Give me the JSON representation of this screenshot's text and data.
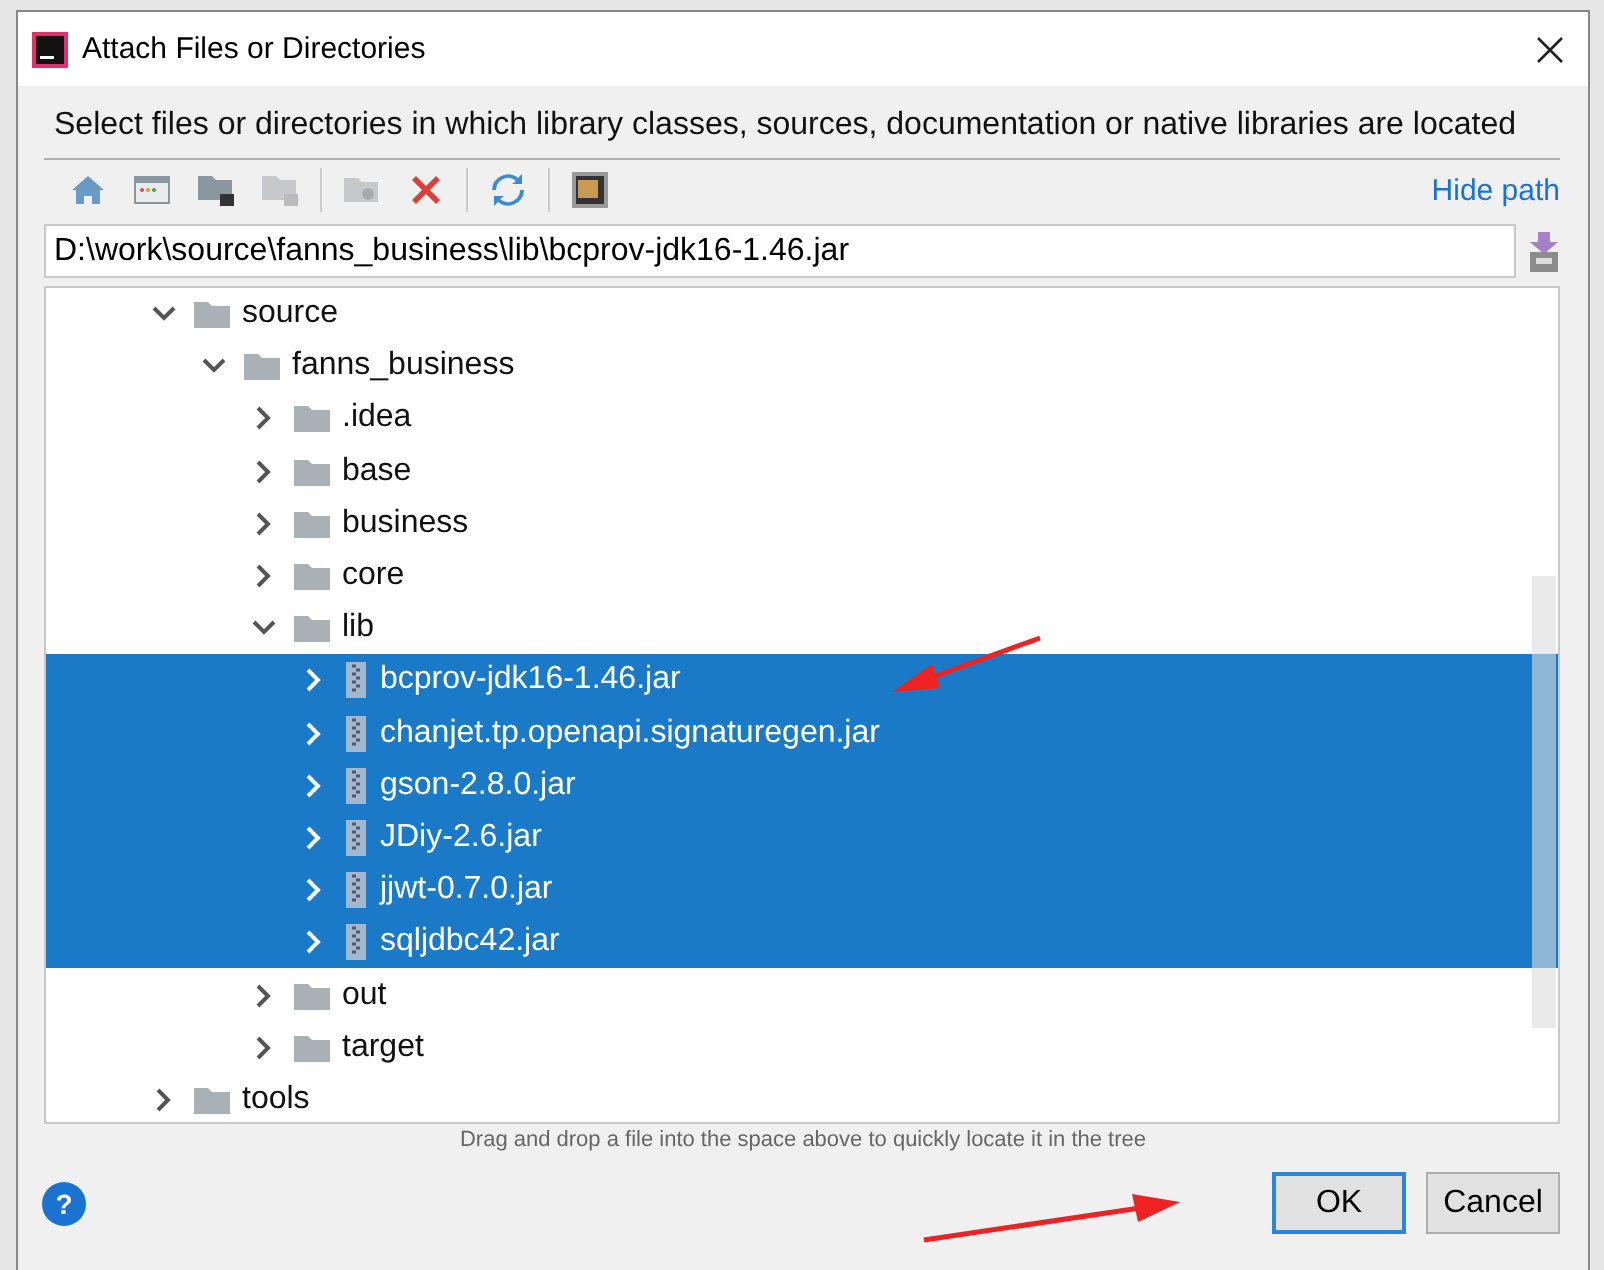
{
  "window": {
    "title": "Attach Files or Directories"
  },
  "description": "Select files or directories in which library classes, sources, documentation or native libraries are located",
  "hide_path_link": "Hide path",
  "path": {
    "value": "D:\\work\\source\\fanns_business\\lib\\bcprov-jdk16-1.46.jar"
  },
  "tree": [
    {
      "label": "source",
      "kind": "folder",
      "expanded": true,
      "selected": false,
      "children": [
        {
          "label": "fanns_business",
          "kind": "folder",
          "expanded": true,
          "selected": false,
          "children": [
            {
              "label": ".idea",
              "kind": "folder",
              "expanded": false,
              "selected": false
            },
            {
              "label": "base",
              "kind": "folder",
              "expanded": false,
              "selected": false
            },
            {
              "label": "business",
              "kind": "folder",
              "expanded": false,
              "selected": false
            },
            {
              "label": "core",
              "kind": "folder",
              "expanded": false,
              "selected": false
            },
            {
              "label": "lib",
              "kind": "folder",
              "expanded": true,
              "selected": false,
              "children": [
                {
                  "label": "bcprov-jdk16-1.46.jar",
                  "kind": "jar",
                  "expanded": false,
                  "selected": true
                },
                {
                  "label": "chanjet.tp.openapi.signaturegen.jar",
                  "kind": "jar",
                  "expanded": false,
                  "selected": true
                },
                {
                  "label": "gson-2.8.0.jar",
                  "kind": "jar",
                  "expanded": false,
                  "selected": true
                },
                {
                  "label": "JDiy-2.6.jar",
                  "kind": "jar",
                  "expanded": false,
                  "selected": true
                },
                {
                  "label": "jjwt-0.7.0.jar",
                  "kind": "jar",
                  "expanded": false,
                  "selected": true
                },
                {
                  "label": "sqljdbc42.jar",
                  "kind": "jar",
                  "expanded": false,
                  "selected": true
                }
              ]
            },
            {
              "label": "out",
              "kind": "folder",
              "expanded": false,
              "selected": false
            },
            {
              "label": "target",
              "kind": "folder",
              "expanded": false,
              "selected": false
            }
          ]
        }
      ]
    },
    {
      "label": "tools",
      "kind": "folder",
      "expanded": false,
      "selected": false
    }
  ],
  "hint": "Drag and drop a file into the space above to quickly locate it in the tree",
  "help_button": "?",
  "buttons": [
    {
      "label": "OK",
      "default": true
    },
    {
      "label": "Cancel",
      "default": false
    }
  ]
}
